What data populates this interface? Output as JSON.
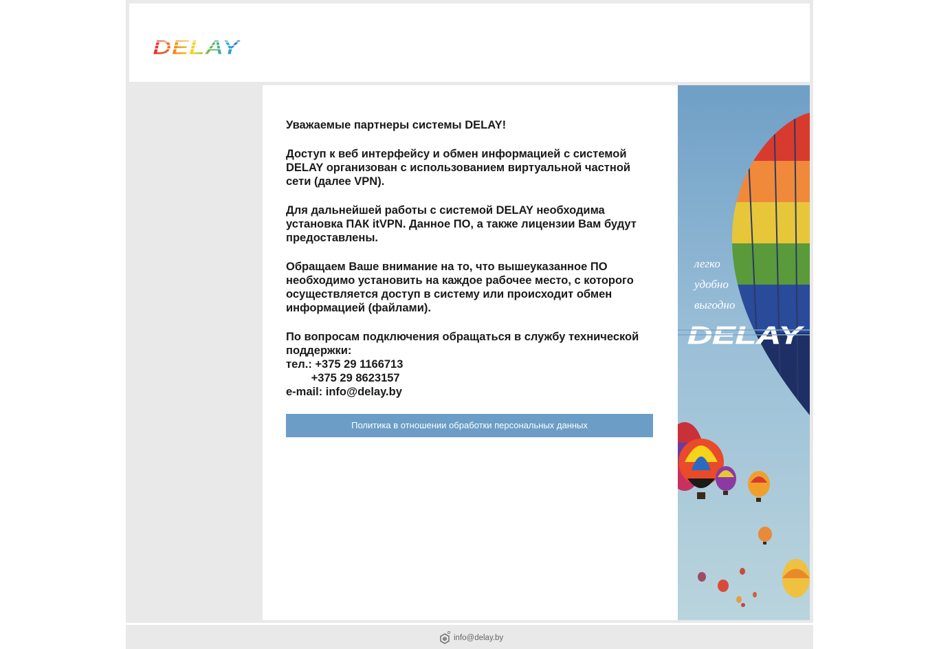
{
  "header": {
    "logo_text": "DELAY"
  },
  "content": {
    "greeting": "Уважаемые партнеры системы DELAY!",
    "paragraph_vpn": "Доступ к веб интерфейсу и обмен информацией с системой DELAY организован с использованием виртуальной частной сети (далее VPN).",
    "paragraph_install": "Для дальнейшей работы с системой DELAY необходима установка ПАК itVPN. Данное ПО, а также лицензии Вам будут предоставлены.",
    "paragraph_attention": "Обращаем Ваше внимание на то, что вышеуказанное ПО необходимо установить на каждое рабочее место, с которого осуществляется доступ в систему или происходит обмен информацией (файлами).",
    "support_intro": "По вопросам подключения обращаться в службу технической поддержки:",
    "phone_line_1": "тел.: +375 29 1166713",
    "phone_line_2": "        +375 29 8623157",
    "email_line": "e-mail: info@delay.by"
  },
  "policy": {
    "label": "Политика в отношении обработки персональных данных"
  },
  "banner": {
    "slogan_1": "легко",
    "slogan_2": "удобно",
    "slogan_3": "выгодно",
    "brand": "DELAY"
  },
  "footer": {
    "email": "info@delay.by"
  },
  "colors": {
    "page_bg": "#e9e9e9",
    "policy_bar": "#6c9dc6",
    "sky_top": "#6f9fc6",
    "sky_bottom": "#b9d4dc"
  }
}
